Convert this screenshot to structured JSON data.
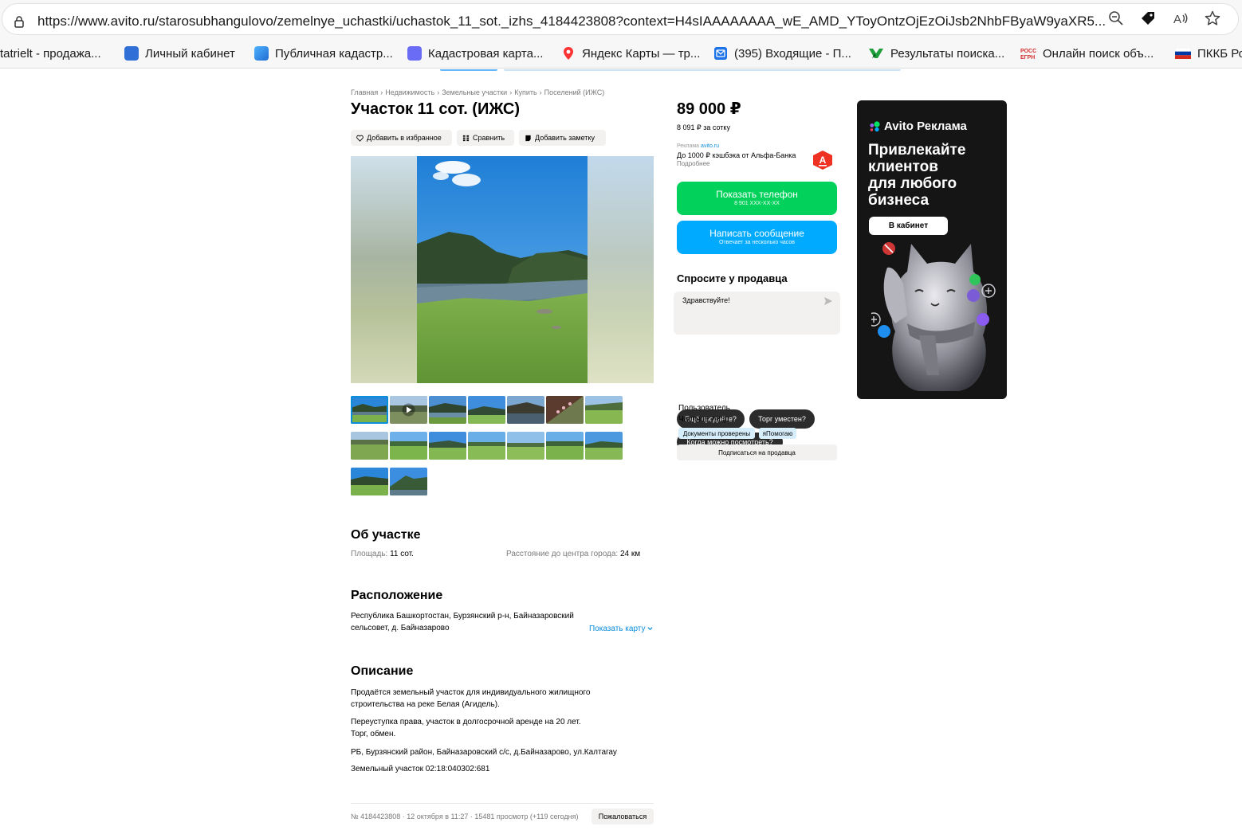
{
  "browser": {
    "url": "https://www.avito.ru/starosubhangulovo/zemelnye_uchastki/uchastok_11_sot._izhs_4184423808?context=H4sIAAAAAAAA_wE_AMD_YToyOntzOjEzOiJsb2NhbFByaW9yaXR5...",
    "toolbar_icons": [
      "zoom-out-icon",
      "shopping-tag-icon",
      "read-aloud-icon",
      "favorite-star-icon"
    ],
    "bookmarks": [
      {
        "label": "tatrielt - продажа...",
        "icon": "none"
      },
      {
        "label": "Личный кабинет",
        "icon": "gosuslugi-icon"
      },
      {
        "label": "Публичная кадастр...",
        "icon": "kadastr-icon"
      },
      {
        "label": "Кадастровая карта...",
        "icon": "map-purple-icon"
      },
      {
        "label": "Яндекс Карты — тр...",
        "icon": "map-pin-icon"
      },
      {
        "label": "(395) Входящие - П...",
        "icon": "mail-icon"
      },
      {
        "label": "Результаты поиска...",
        "icon": "search-green-icon"
      },
      {
        "label": "Онлайн поиск объ...",
        "icon": "rosreestr-icon"
      },
      {
        "label": "ПККБ Ро",
        "icon": "russia-flag-icon"
      }
    ]
  },
  "breadcrumbs": [
    "Главная",
    "Недвижимость",
    "Земельные участки",
    "Купить",
    "Поселений (ИЖС)"
  ],
  "breadcrumb_separator": "›",
  "listing": {
    "title": "Участок 11 сот. (ИЖС)",
    "actions": {
      "favorite": "Добавить в избранное",
      "compare": "Сравнить",
      "note": "Добавить заметку"
    },
    "about": {
      "heading": "Об участке",
      "area_label": "Площадь:",
      "area_value": "11 сот.",
      "distance_label": "Расстояние до центра города:",
      "distance_value": "24 км"
    },
    "location": {
      "heading": "Расположение",
      "address_line1": "Республика Башкортостан, Бурзянский р-н, Байназаровский",
      "address_line2": "сельсовет, д. Байназарово",
      "show_map": "Показать карту"
    },
    "description": {
      "heading": "Описание",
      "p1_line1": "Продаётся земельный участок для индивидуального жилищного",
      "p1_line2": "строительства на реке Белая (Агидель).",
      "p2_line1": "Переуступка права, участок в долгосрочной аренде на 20 лет.",
      "p2_line2": "Торг, обмен.",
      "p3": "РБ, Бурзянский район, Байназаровский с/с, д.Байназарово, ул.Калтагау",
      "p4": "Земельный участок 02:18:040302:681"
    },
    "footer": {
      "meta": "№ 4184423808 · 12 октября в 11:27 · 15481 просмотр (+119 сегодня)",
      "report": "Пожаловаться"
    }
  },
  "sidebar": {
    "price": "89 000 ₽",
    "price_per": "8 091 ₽ за сотку",
    "promo_tag": "Реклама",
    "promo_source": "avito.ru",
    "promo_text": "До 1000 ₽ кэшбэка от Альфа-Банка",
    "promo_more": "Подробнее",
    "show_phone": "Показать телефон",
    "phone_masked": "8 901 XXX-XX-XX",
    "write_message": "Написать сообщение",
    "reply_time": "Отвечает за несколько часов",
    "ask_title": "Спросите у продавца",
    "ask_placeholder": "Здравствуйте!",
    "quick_replies": [
      "Ещё продаёте?",
      "Торг уместен?",
      "Когда можно посмотреть?"
    ],
    "seller_name": "Пользователь",
    "seller_type": "Частное лицо",
    "badges": [
      "Документы проверены",
      "яПомогаю"
    ],
    "subscribe": "Подписаться на продавца"
  },
  "ad": {
    "brand": "Avito Реклама",
    "headline_l1": "Привлекайте",
    "headline_l2": "клиентов",
    "headline_l3": "для любого",
    "headline_l4": "бизнеса",
    "button": "В кабинет"
  },
  "colors": {
    "green_button": "#02d15c",
    "blue_button": "#00aaff",
    "link": "#0a8ddb",
    "ad_background": "#151515",
    "chip_background": "#2c2c2c",
    "badge_background": "#d6eefc"
  }
}
